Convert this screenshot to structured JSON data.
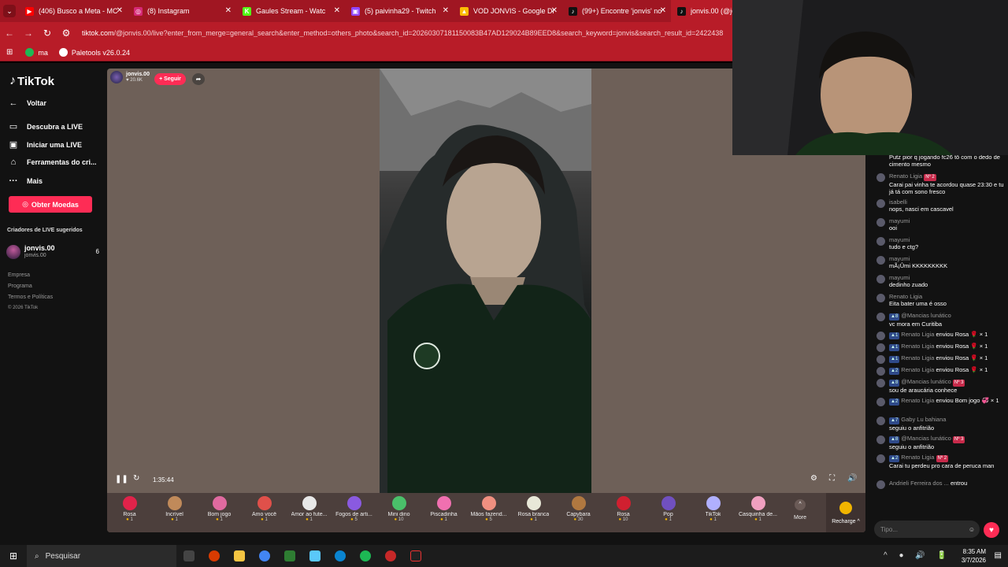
{
  "browser": {
    "tabs": [
      {
        "title": "(406) Busco a Meta - MC",
        "icon_color": "#ff0000",
        "icon_glyph": "▶"
      },
      {
        "title": "(8) Instagram",
        "icon_color": "#d62976",
        "icon_glyph": "◎"
      },
      {
        "title": "Gaules Stream - Watc",
        "icon_color": "#53fc18",
        "icon_glyph": "K"
      },
      {
        "title": "(5) paivinha29 - Twitch",
        "icon_color": "#9146ff",
        "icon_glyph": "▣"
      },
      {
        "title": "VOD JONVIS - Google Dr",
        "icon_color": "#fbbc04",
        "icon_glyph": "▲"
      },
      {
        "title": "(99+) Encontre 'jonvis' no",
        "icon_color": "#111111",
        "icon_glyph": "♪"
      },
      {
        "title": "jonvis.00 (@jo",
        "icon_color": "#111111",
        "icon_glyph": "♪"
      }
    ],
    "url_host": "tiktok.com",
    "url_rest": "/@jonvis.00/live?enter_from_merge=general_search&enter_method=others_photo&search_id=20260307181150083B47AD129024B89EED8&search_keyword=jonvis&search_result_id=2422438",
    "bookmarks": [
      {
        "label": "ma",
        "icon_color": "#1db954"
      },
      {
        "label": "Paletools v26.0.24",
        "icon_color": "#ffffff"
      }
    ]
  },
  "sidebar": {
    "brand": "TikTok",
    "nav": [
      {
        "label": "Voltar",
        "icon": "back-arrow-icon"
      },
      {
        "label": "Descubra a LIVE",
        "icon": "live-icon"
      },
      {
        "label": "Iniciar uma LIVE",
        "icon": "camera-icon"
      },
      {
        "label": "Ferramentas do cri...",
        "icon": "home-icon"
      },
      {
        "label": "Mais",
        "icon": "more-icon"
      }
    ],
    "coins_button": "Obter Moedas",
    "suggested_title": "Criadores de LIVE sugeridos",
    "suggested": {
      "name": "jonvis.00",
      "handle": "jonvis.00",
      "count": "6"
    },
    "footer": [
      "Empresa",
      "Programa",
      "Termos e Políticas",
      "© 2026 TikTok"
    ]
  },
  "stream": {
    "streamer_name": "jonvis.00",
    "viewers": "20.6K",
    "follow_label": "+ Seguir",
    "elapsed": "1:35:44"
  },
  "gifts": [
    {
      "name": "Rosa",
      "price": "1",
      "color": "#e0234a"
    },
    {
      "name": "Incrível",
      "price": "1",
      "color": "#c08a5a"
    },
    {
      "name": "Bom jogo",
      "price": "1",
      "color": "#e06aa0"
    },
    {
      "name": "Amo você",
      "price": "1",
      "color": "#e0504a"
    },
    {
      "name": "Amor ao fute...",
      "price": "1",
      "color": "#e8e8e8"
    },
    {
      "name": "Fogos de arti...",
      "price": "5",
      "color": "#8a5ae0"
    },
    {
      "name": "Mini dino",
      "price": "10",
      "color": "#4ac06a"
    },
    {
      "name": "Piscadinha",
      "price": "1",
      "color": "#f070b0"
    },
    {
      "name": "Mãos fazend...",
      "price": "5",
      "color": "#f09080"
    },
    {
      "name": "Rosa branca",
      "price": "1",
      "color": "#e8e8d8"
    },
    {
      "name": "Capybara",
      "price": "30",
      "color": "#b07840"
    },
    {
      "name": "Rosa",
      "price": "10",
      "color": "#d02030"
    },
    {
      "name": "Pop",
      "price": "1",
      "color": "#7050c0"
    },
    {
      "name": "TikTok",
      "price": "1",
      "color": "#b0b0ff"
    },
    {
      "name": "Casquinha de...",
      "price": "1",
      "color": "#f0a0c0"
    }
  ],
  "gift_more": "More",
  "recharge": "Recharge ^",
  "chat": [
    {
      "user": "",
      "text": "Putz pior q jogando fc26 tô com o dedo de cimento mesmo"
    },
    {
      "user": "Renato Ligia",
      "badge": "Nº 2",
      "text": "Carai pai vinha te acordou quase 23:30 e tu já tá com sono fresco"
    },
    {
      "user": "isabelli",
      "text": "nops, nasci em cascavel"
    },
    {
      "user": "mayumi",
      "text": "ooi"
    },
    {
      "user": "mayumi",
      "text": "tudo e ctg?"
    },
    {
      "user": "mayumi",
      "text": "mÃ¡Ûmi KKKKKKKKK"
    },
    {
      "user": "mayumi",
      "text": "dedinho zuado"
    },
    {
      "user": "Renato Ligia",
      "text": "Eita bater uma é osso"
    },
    {
      "user": "@Mancias lunático",
      "level": "8",
      "text": "vc mora em Curitiba"
    },
    {
      "user": "Renato Ligia",
      "level": "1",
      "inline": "enviou Rosa 🌹 × 1"
    },
    {
      "user": "Renato Ligia",
      "level": "1",
      "inline": "enviou Rosa 🌹 × 1"
    },
    {
      "user": "Renato Ligia",
      "level": "1",
      "inline": "enviou Rosa 🌹 × 1"
    },
    {
      "user": "Renato Ligia",
      "level": "2",
      "inline": "enviou Rosa 🌹 × 1"
    },
    {
      "user": "@Mancias lunático",
      "level": "8",
      "badge": "Nº 3",
      "text": "sou de araucária conhece"
    },
    {
      "user": "Renato Ligia",
      "level": "2",
      "inline": "enviou Bom jogo 💞 × 1"
    },
    {
      "user": "Gaby Lu bahiana",
      "level": "7",
      "text": "seguiu o anfitrião"
    },
    {
      "user": "@Mancias lunático",
      "level": "8",
      "badge": "Nº 3",
      "text": "seguiu o anfitrião"
    },
    {
      "user": "Renato Ligia",
      "level": "2",
      "badge": "Nº 2",
      "text": "Carai tu perdeu pro cara de peruca man"
    },
    {
      "user": "Andrieli Ferreira dos ...",
      "inline": "entrou"
    }
  ],
  "chat_input_placeholder": "Tipo...",
  "taskbar": {
    "search": "Pesquisar",
    "time": "8:35 AM",
    "date": "3/7/2026"
  }
}
